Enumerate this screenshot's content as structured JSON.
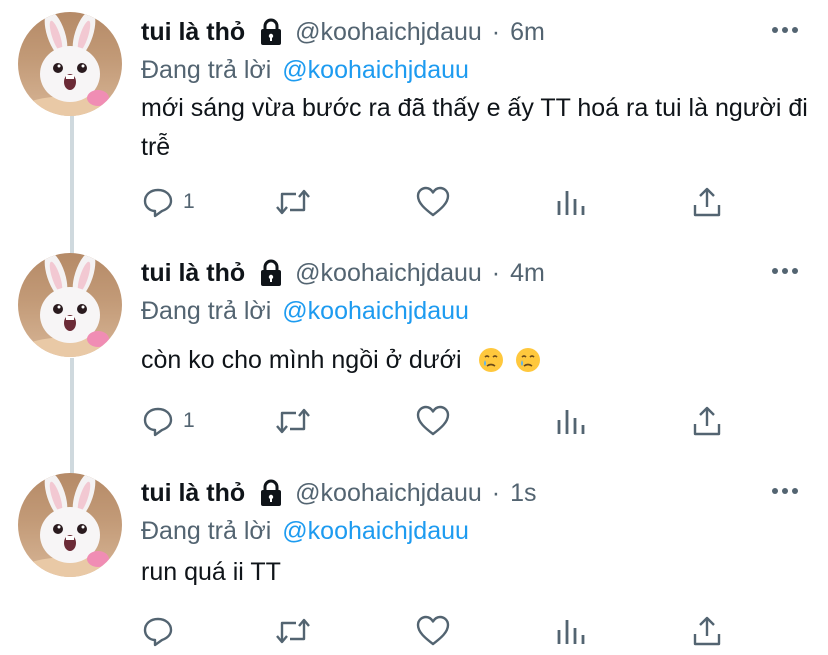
{
  "thread": {
    "tweets": [
      {
        "display_name": "tui là thỏ",
        "handle": "@koohaichjdauu",
        "separator": "·",
        "time": "6m",
        "replying_label": "Đang trả lời",
        "replying_to": "@koohaichjdauu",
        "text": "mới sáng vừa bước ra đã thấy e ấy TT hoá ra tui là người đi trễ",
        "emoji_suffix": [],
        "reply_count": "1",
        "icons": [
          "lock-icon",
          "more-icon",
          "reply-icon",
          "retweet-icon",
          "like-icon",
          "analytics-icon",
          "share-icon"
        ]
      },
      {
        "display_name": "tui là thỏ",
        "handle": "@koohaichjdauu",
        "separator": "·",
        "time": "4m",
        "replying_label": "Đang trả lời",
        "replying_to": "@koohaichjdauu",
        "text": "còn ko cho mình ngồi ở dưới",
        "emoji_suffix": [
          "crying-face",
          "crying-face"
        ],
        "reply_count": "1",
        "icons": [
          "lock-icon",
          "more-icon",
          "reply-icon",
          "retweet-icon",
          "like-icon",
          "analytics-icon",
          "share-icon"
        ]
      },
      {
        "display_name": "tui là thỏ",
        "handle": "@koohaichjdauu",
        "separator": "·",
        "time": "1s",
        "replying_label": "Đang trả lời",
        "replying_to": "@koohaichjdauu",
        "text": "run quá ii TT",
        "emoji_suffix": [],
        "reply_count": "",
        "icons": [
          "lock-icon",
          "more-icon",
          "reply-icon",
          "retweet-icon",
          "like-icon",
          "analytics-icon",
          "share-icon"
        ]
      }
    ]
  },
  "colors": {
    "text_primary": "#0f1419",
    "text_secondary": "#536471",
    "accent_blue": "#1d9bf0",
    "thread_line": "#cfd9de"
  }
}
